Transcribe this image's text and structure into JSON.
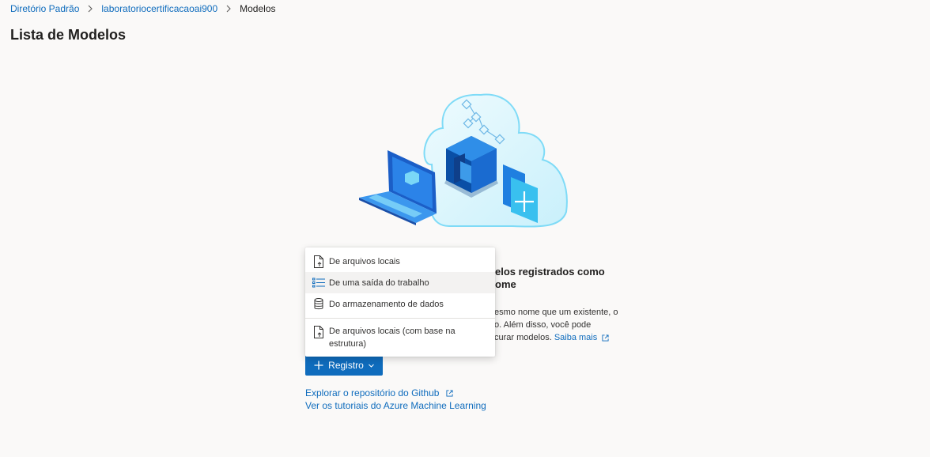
{
  "breadcrumb": {
    "items": [
      "Diretório Padrão",
      "laboratoriocertificacaoai900",
      "Modelos"
    ]
  },
  "page": {
    "title": "Lista de Modelos"
  },
  "empty_state": {
    "title_visible": "elos registrados como\nome",
    "description_lines": [
      "esmo nome que um existente, o",
      "o. Além disso, você pode",
      "curar modelos."
    ],
    "learn_more": "Saiba mais"
  },
  "register_menu": {
    "items": [
      {
        "label": "De arquivos locais",
        "icon": "file-upload-icon"
      },
      {
        "label": "De uma saída do trabalho",
        "icon": "job-output-list-icon"
      },
      {
        "label": "Do armazenamento de dados",
        "icon": "database-icon"
      },
      {
        "label": "De arquivos locais (com base na estrutura)",
        "icon": "file-upload-icon"
      }
    ],
    "highlighted_index": 1
  },
  "register_button": {
    "label": "Registro",
    "icon": "plus-icon"
  },
  "links": {
    "github": "Explorar o repositório do Github",
    "tutorials": "Ver os tutoriais do Azure Machine Learning"
  },
  "colors": {
    "accent": "#0f6cbd",
    "background": "#faf9f8",
    "menu_highlight": "#f3f2f1"
  }
}
